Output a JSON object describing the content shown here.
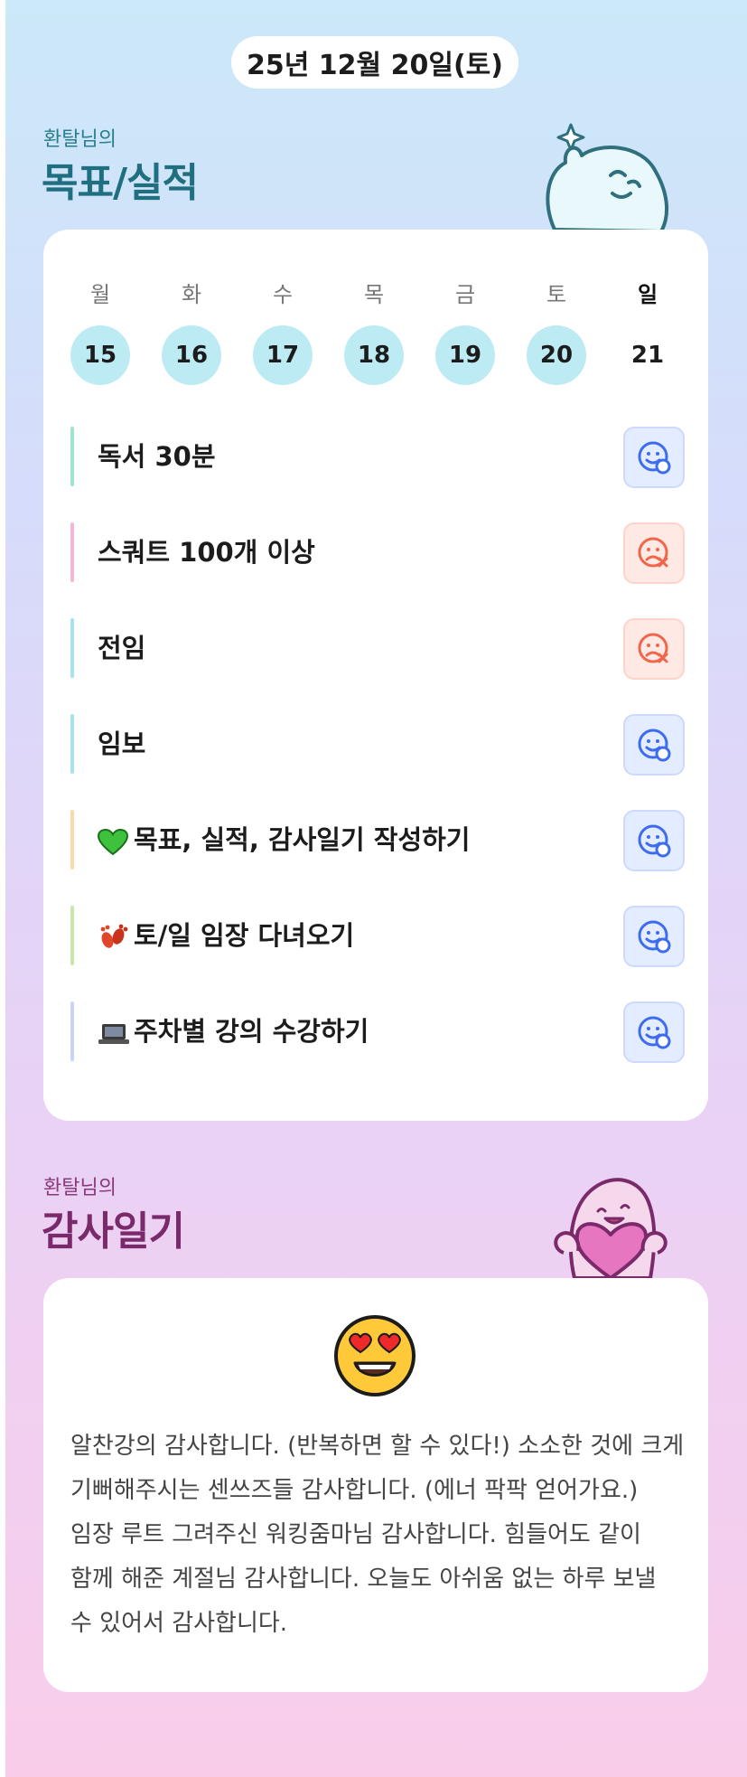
{
  "header": {
    "date": "25년 12월 20일(토)"
  },
  "goals_section": {
    "user_label": "환탈님의",
    "title": "목표/실적"
  },
  "week": {
    "day_names": [
      "월",
      "화",
      "수",
      "목",
      "금",
      "토",
      "일"
    ],
    "dates": [
      "15",
      "16",
      "17",
      "18",
      "19",
      "20",
      "21"
    ],
    "completed": [
      true,
      true,
      true,
      true,
      true,
      true,
      false
    ]
  },
  "goals": [
    {
      "emoji": "",
      "label": "독서 30분",
      "status": "success",
      "bar_color": "#9fe3d0"
    },
    {
      "emoji": "",
      "label": "스쿼트 100개 이상",
      "status": "fail",
      "bar_color": "#f7b6d8"
    },
    {
      "emoji": "",
      "label": "전임",
      "status": "fail",
      "bar_color": "#a6e3ef"
    },
    {
      "emoji": "",
      "label": "임보",
      "status": "success",
      "bar_color": "#a6e3ef"
    },
    {
      "emoji": "💚",
      "label": "목표, 실적, 감사일기 작성하기",
      "status": "success",
      "bar_color": "#fcd9a8"
    },
    {
      "emoji": "👣",
      "label": "토/일 임장 다녀오기",
      "status": "success",
      "bar_color": "#c9e7a6"
    },
    {
      "emoji": "💻",
      "label": "주차별 강의 수강하기",
      "status": "success",
      "bar_color": "#c7d4f7"
    }
  ],
  "diary_section": {
    "user_label": "환탈님의",
    "title": "감사일기"
  },
  "diary": {
    "mood_icon": "heart-eyes-emoji-icon",
    "text": "알찬강의 감사합니다. (반복하면 할 수 있다!) 소소한 것에 크게 기뻐해주시는 센쓰즈들 감사합니다. (에너 팍팍 얻어가요.) 임장 루트 그려주신 워킹줌마님 감사합니다. 힘들어도 같이 함께 해준 계절님 감사합니다. 오늘도 아쉬움 없는 하루 보낼 수 있어서 감사합니다."
  },
  "colors": {
    "goal_title": "#1f6f80",
    "diary_title": "#7a2a6a",
    "success_icon": "#3d6cf0",
    "fail_icon": "#f0664a",
    "completed_day": "#bdebf4"
  }
}
